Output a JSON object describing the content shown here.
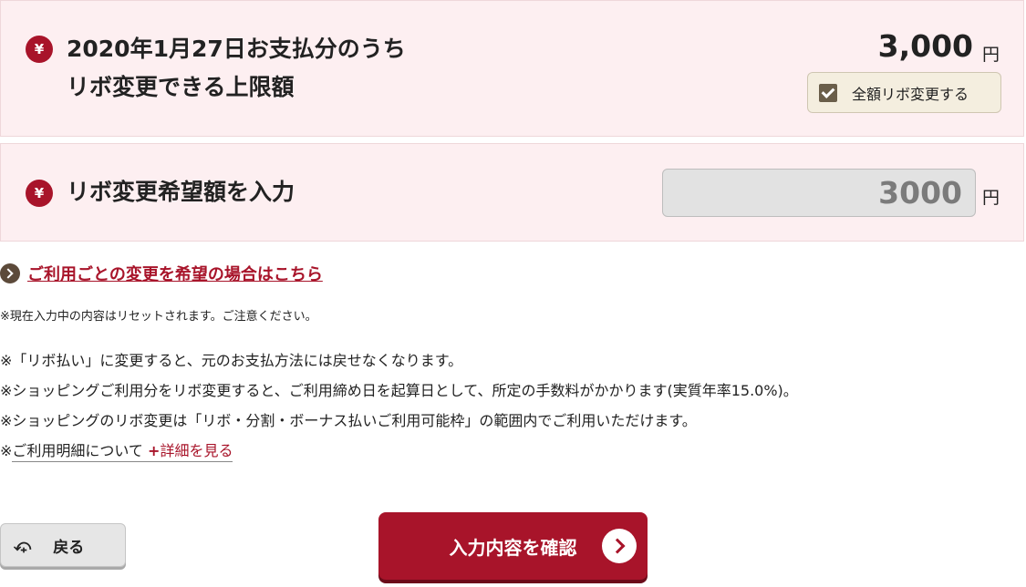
{
  "limit_section": {
    "title_line1": "2020年1月27日お支払分のうち",
    "title_line2": "リボ変更できる上限額",
    "amount": "3,000",
    "unit": "円",
    "full_change_label": "全額リボ変更する",
    "full_change_checked": true
  },
  "input_section": {
    "title": "リボ変更希望額を入力",
    "value": "3000",
    "unit": "円"
  },
  "per_use_link": "ご利用ごとの変更を希望の場合はこちら",
  "reset_note": "※現在入力中の内容はリセットされます。ご注意ください。",
  "notes": [
    "※「リボ払い」に変更すると、元のお支払方法には戻せなくなります。",
    "※ショッピングご利用分をリボ変更すると、ご利用締め日を起算日として、所定の手数料がかかります(実質年率15.0%)。",
    "※ショッピングのリボ変更は「リボ・分割・ボーナス払いご利用可能枠」の範囲内でご利用いただけます。"
  ],
  "statement_note": {
    "prefix": "※",
    "text": "ご利用明細について",
    "plus": "+",
    "detail": "詳細を見る"
  },
  "yen_icon": "¥",
  "back_icon": "⤽",
  "back_label": "戻る",
  "confirm_label": "入力内容を確認",
  "colors": {
    "accent_red": "#a8142a",
    "panel_pink": "#fdeff1",
    "checkbox_brown": "#6a5e4a"
  }
}
